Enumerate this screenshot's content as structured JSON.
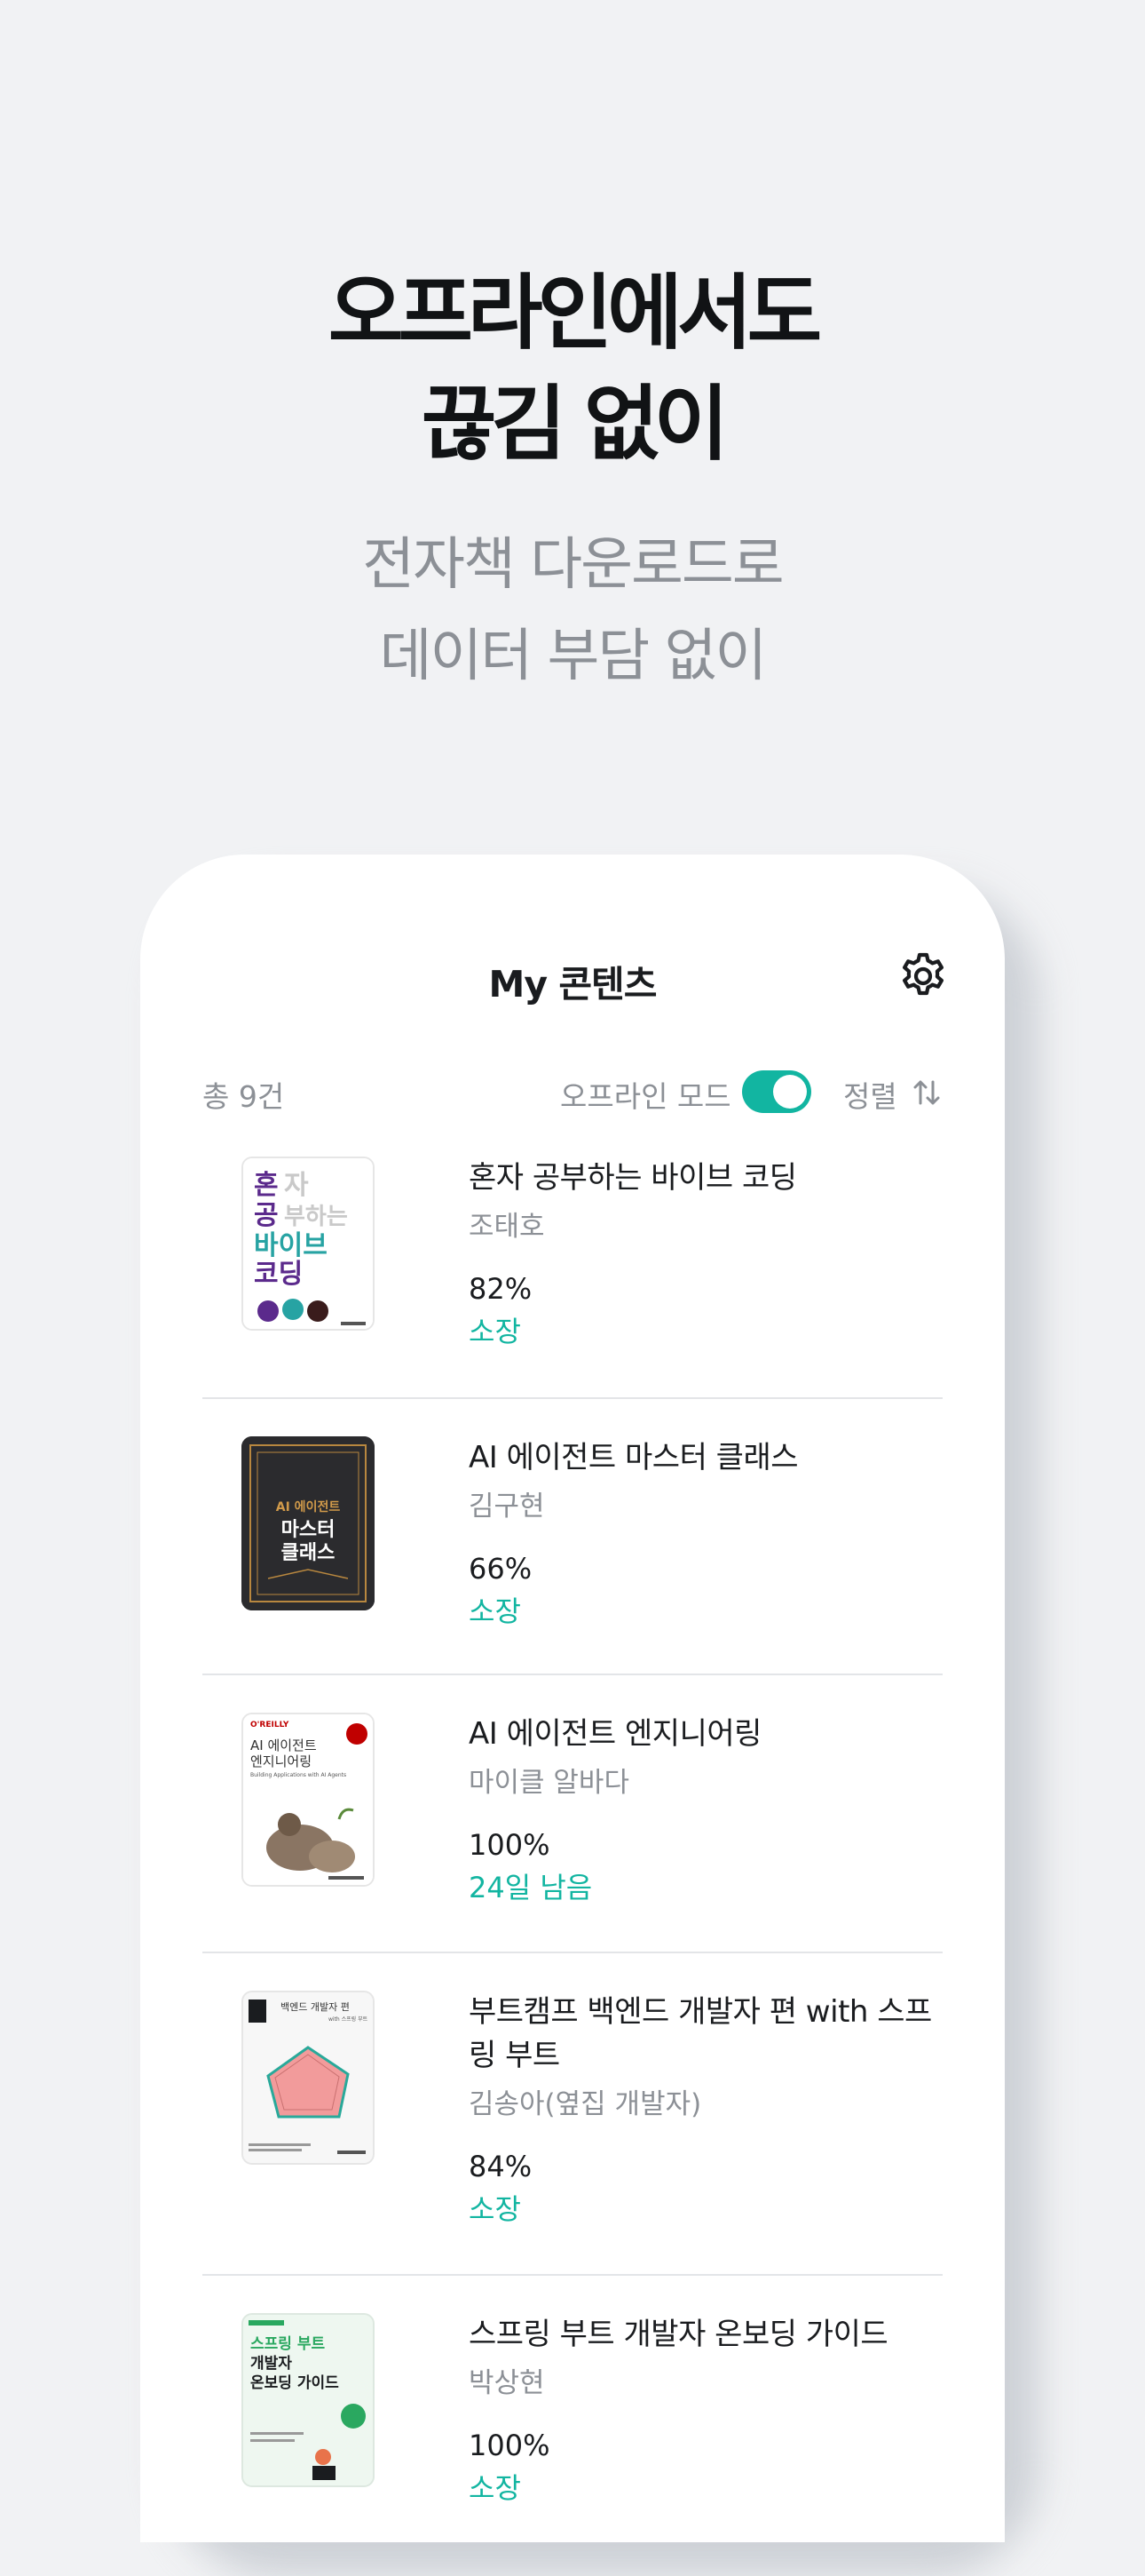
{
  "hero": {
    "title_line1": "오프라인에서도",
    "title_line2": "끊김 없이",
    "subtitle_line1": "전자책 다운로드로",
    "subtitle_line2": "데이터 부담 없이"
  },
  "app": {
    "title": "My 콘텐츠",
    "settings_icon": "gear-icon"
  },
  "toolbar": {
    "count": "총 9건",
    "offline_label": "오프라인 모드",
    "offline_enabled": true,
    "sort_label": "정렬",
    "sort_icon": "sort-arrows-icon"
  },
  "books": [
    {
      "title": "혼자 공부하는 바이브 코딩",
      "author": "조태호",
      "progress": "82%",
      "status": "소장",
      "cover": {
        "text_lines": [
          "혼자",
          "공부하는",
          "바이브",
          "코딩"
        ],
        "colors": [
          "#5b2a8c",
          "#27a3a3",
          "#bfbfbf"
        ]
      }
    },
    {
      "title": "AI 에이전트 마스터 클래스",
      "author": "김구현",
      "progress": "66%",
      "status": "소장",
      "cover": {
        "text_lines": [
          "AI 에이전트",
          "마스터",
          "클래스"
        ],
        "colors": [
          "#2b2b2e",
          "#d19a4a",
          "#ffffff"
        ]
      }
    },
    {
      "title": "AI 에이전트 엔지니어링",
      "author": "마이클 알바다",
      "progress": "100%",
      "status": "24일 남음",
      "cover": {
        "text_lines": [
          "O'REILLY",
          "AI 에이전트",
          "엔지니어링",
          "Building Applications with AI Agents"
        ],
        "colors": [
          "#ffffff",
          "#c00000",
          "#333333"
        ]
      }
    },
    {
      "title": "부트캠프 백엔드 개발자 편 with 스프링 부트",
      "author": "김송아(옆집 개발자)",
      "progress": "84%",
      "status": "소장",
      "cover": {
        "text_lines": [
          "백엔드 개발자 편",
          "with 스프링 부트"
        ],
        "colors": [
          "#f2f2f2",
          "#f29b9b",
          "#29a99a"
        ]
      }
    },
    {
      "title": "스프링 부트 개발자 온보딩 가이드",
      "author": "박상현",
      "progress": "100%",
      "status": "소장",
      "cover": {
        "text_lines": [
          "스프링 부트",
          "개발자",
          "온보딩 가이드"
        ],
        "colors": [
          "#e8f5ec",
          "#2aa860",
          "#1a1c1f"
        ]
      }
    }
  ]
}
